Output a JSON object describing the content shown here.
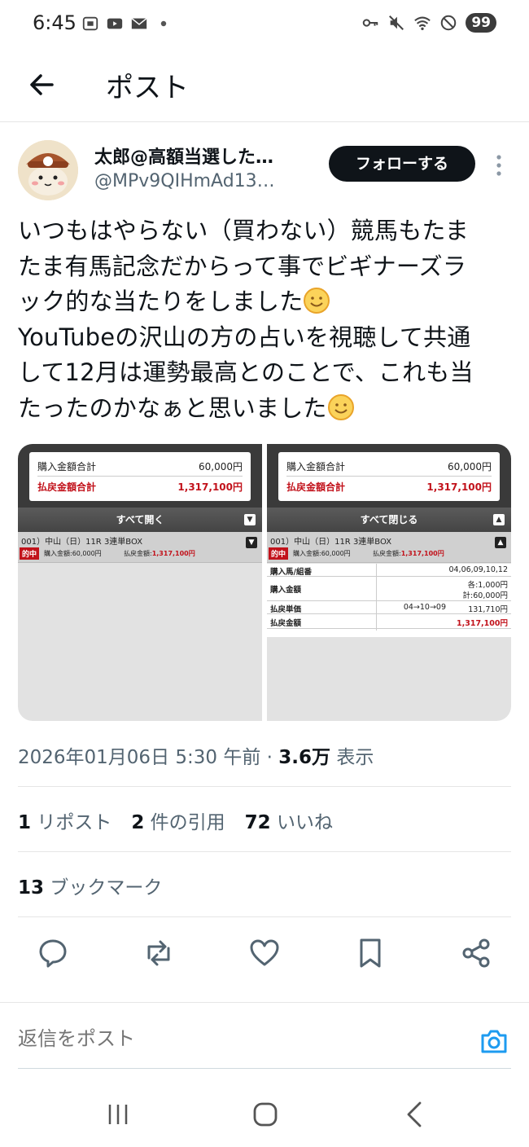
{
  "status_bar": {
    "time": "6:45",
    "left_icons": [
      "screenshot-icon",
      "youtube-icon",
      "mail-icon",
      "dot-icon"
    ],
    "right_icons": [
      "key-icon",
      "mute-icon",
      "wifi-icon",
      "no-sign-icon"
    ],
    "battery": "99"
  },
  "header": {
    "title": "ポスト"
  },
  "author": {
    "name": "太郎@高額当選した…",
    "handle": "@MPv9QIHmAd13…",
    "follow_label": "フォローする"
  },
  "tweet": {
    "line1": "いつもはやらない（買わない）競馬もたま",
    "line2": "たま有馬記念だからって事でビギナーズラ",
    "line3": "ック的な当たりをしました",
    "line4": "YouTubeの沢山の方の占いを視聴して共通",
    "line5": "して12月は運勢最高とのことで、これも当",
    "line6": "たったのかなぁと思いました"
  },
  "media": {
    "left": {
      "buy_total_label": "購入金額合計",
      "buy_total_value": "60,000円",
      "payout_total_label": "払戻金額合計",
      "payout_total_value": "1,317,100円",
      "toggle_label": "すべて開く",
      "race_title": "001）中山（日）11R 3連単BOX",
      "hit_badge": "的中",
      "buy_amount": "購入金額:60,000円",
      "payout_label": "払戻金額:",
      "payout_amount": "1,317,100円"
    },
    "right": {
      "buy_total_label": "購入金額合計",
      "buy_total_value": "60,000円",
      "payout_total_label": "払戻金額合計",
      "payout_total_value": "1,317,100円",
      "toggle_label": "すべて閉じる",
      "race_title": "001）中山（日）11R 3連単BOX",
      "hit_badge": "的中",
      "buy_amount": "購入金額:60,000円",
      "payout_label": "払戻金額:",
      "payout_amount": "1,317,100円",
      "detail": {
        "horses_label": "購入馬/組番",
        "horses_value": "04,06,09,10,12",
        "amount_label": "購入金額",
        "amount_each": "各:1,000円",
        "amount_total": "計:60,000円",
        "unit_label": "払戻単価",
        "unit_combo": "04→10→09",
        "unit_value": "131,710円",
        "payout_label": "払戻金額",
        "payout_value": "1,317,100円"
      }
    }
  },
  "meta": {
    "datetime": "2026年01月06日 5:30 午前 · ",
    "views_count": "3.6万",
    "views_label": " 表示"
  },
  "stats": {
    "reposts_count": "1",
    "reposts_label": " リポスト",
    "quotes_count": "2",
    "quotes_label": " 件の引用",
    "likes_count": "72",
    "likes_label": " いいね",
    "bookmarks_count": "13",
    "bookmarks_label": " ブックマーク"
  },
  "reply": {
    "placeholder": "返信をポスト"
  },
  "colors": {
    "accent": "#1d9bf0",
    "text": "#0f1419",
    "muted": "#536471",
    "red": "#c2121b",
    "emoji": "#f4b63d"
  }
}
